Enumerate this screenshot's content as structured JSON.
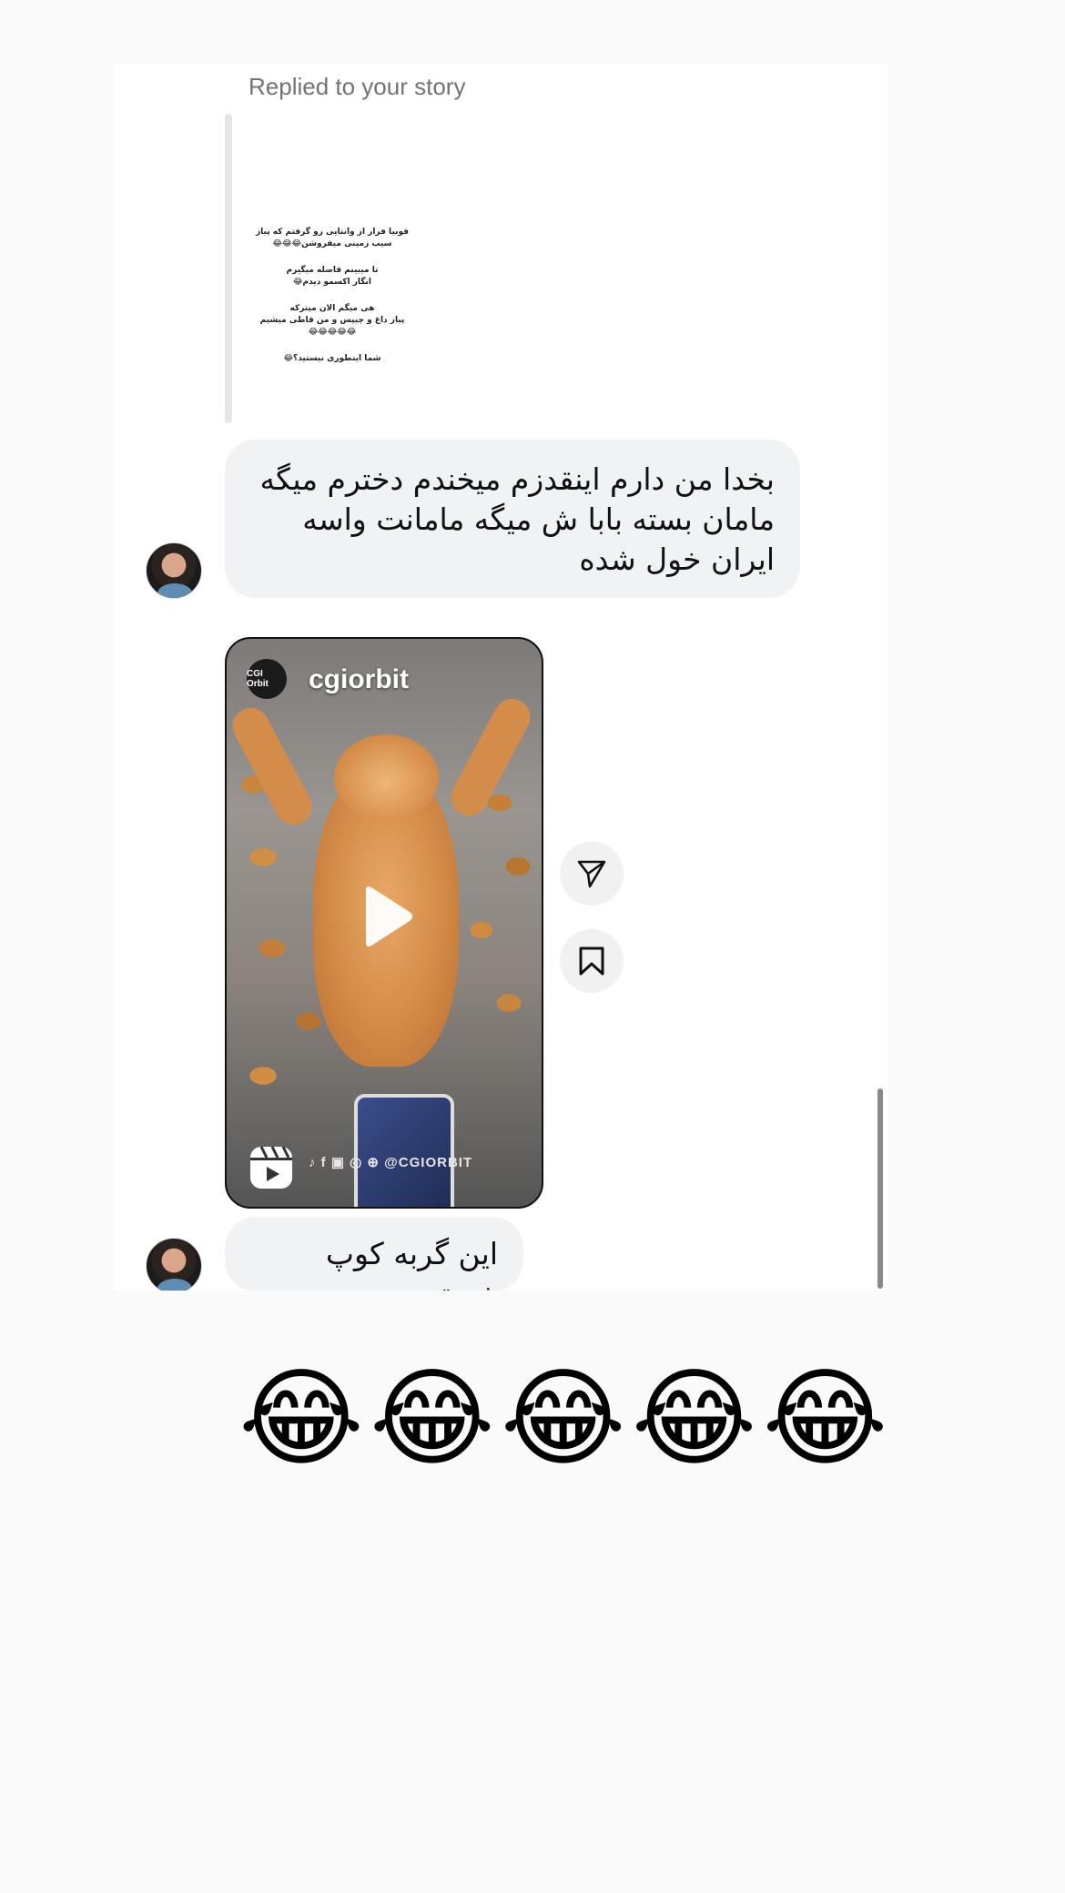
{
  "chat": {
    "reply_label": "Replied to your story",
    "story_lines": [
      "فوبیا فرار از وانتایی رو گرفتم که پیاز",
      "سیب زمینی میفروشن😂😂😂",
      "تا میبینم فاصله میگیرم",
      "انگار اکسمو دیدم😂",
      "هی میگم الان میترکه",
      "پیاز داغ و چیپس و من قاطی میشیم",
      "😂😂😂😂😂",
      "شما اینطوری نیستید؟😂"
    ],
    "message_1": "بخدا من دارم اینقدزم میخندم دخترم میگه مامان بسته بابا ش میگه مامانت واسه ایران خول شده",
    "reel": {
      "username": "cgiorbit",
      "logo_text": "CGI Orbit",
      "watermark": "♪ f ▣ ◎ ⊕ @CGIORBIT"
    },
    "message_2": "این گربه کوپ خودته"
  },
  "caption": "😂😂😂😂😂",
  "colors": {
    "bubble": "#f1f2f4",
    "panel": "#ffffff",
    "background": "#fafafa",
    "muted_text": "#737373"
  },
  "icons": [
    "send-icon",
    "bookmark-icon",
    "play-icon",
    "reels-icon"
  ]
}
